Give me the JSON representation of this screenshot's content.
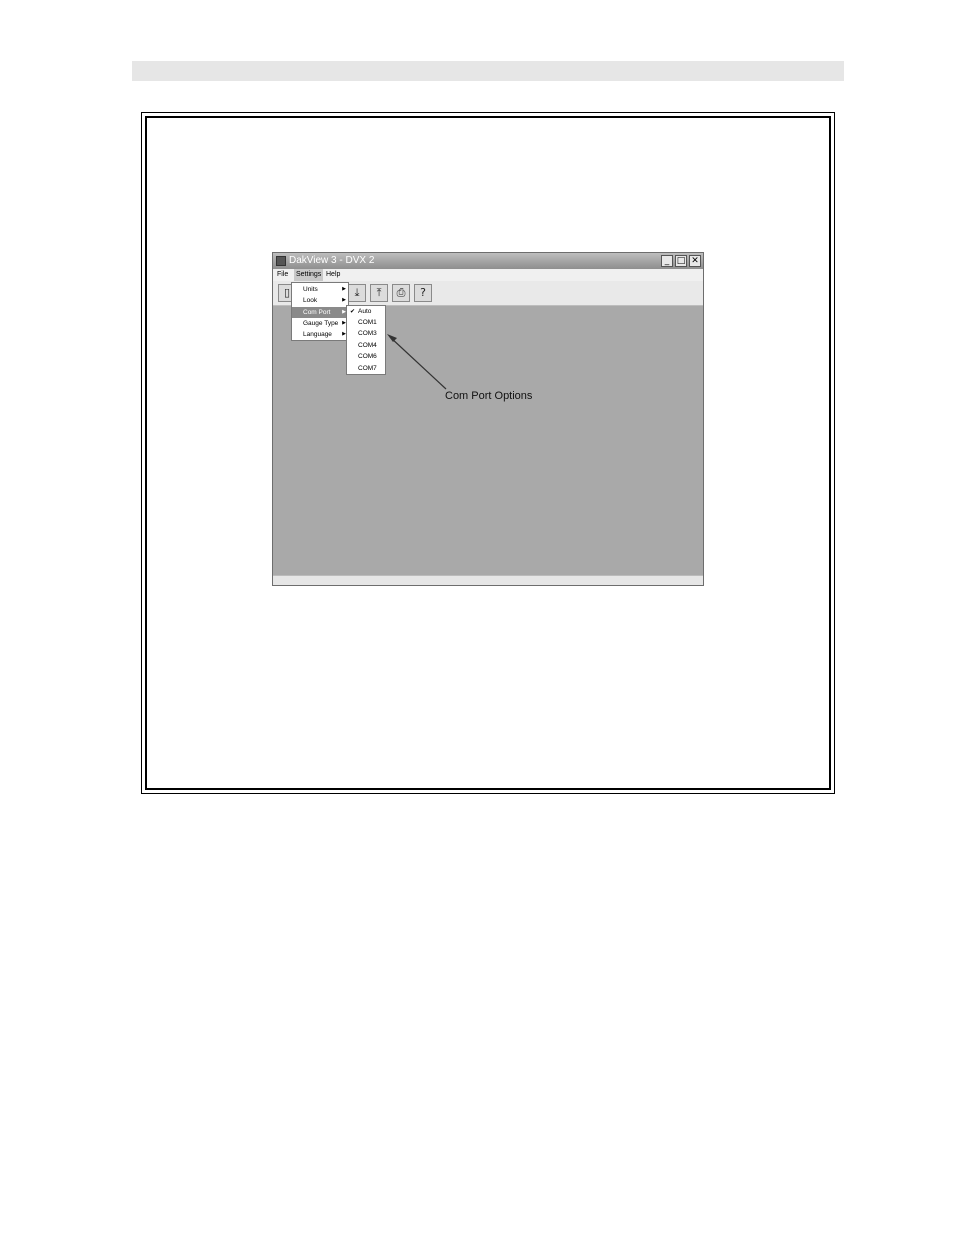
{
  "window": {
    "title": "DakView 3 - DVX 2",
    "controls": [
      "_",
      "□",
      "✕"
    ],
    "menubar": [
      "File",
      "Settings",
      "Help"
    ],
    "toolbar_icons": [
      "open-file-icon",
      "download-icon",
      "upload-icon",
      "print-icon",
      "help-icon"
    ]
  },
  "settings_menu": {
    "items": [
      {
        "label": "Units"
      },
      {
        "label": "Look"
      },
      {
        "label": "Com Port"
      },
      {
        "label": "Gauge Type"
      },
      {
        "label": "Language"
      }
    ],
    "highlighted": "Com Port"
  },
  "com_port_menu": {
    "items": [
      "Auto",
      "COM1",
      "COM3",
      "COM4",
      "COM6",
      "COM7"
    ],
    "checked": "Auto"
  },
  "annotation": {
    "text": "Com Port Options"
  },
  "colors": {
    "workspace": "#a9a9a9",
    "header_bar": "#e6e6e6"
  }
}
